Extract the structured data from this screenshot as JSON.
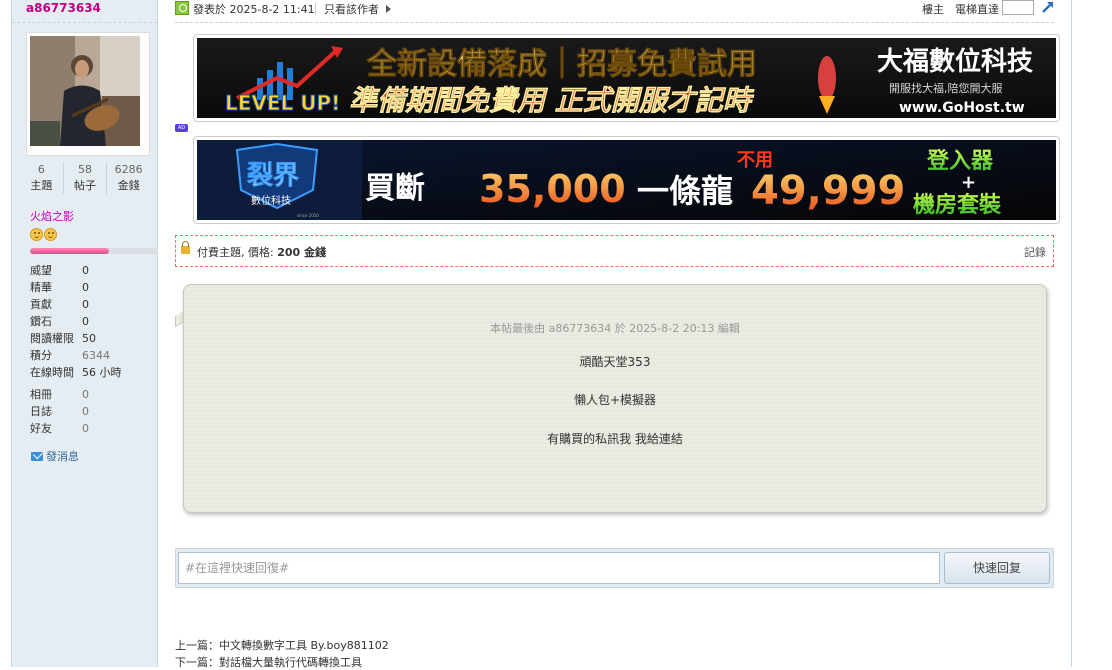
{
  "sidebar": {
    "username": "a86773634",
    "stats": [
      {
        "num": "6",
        "label": "主題"
      },
      {
        "num": "58",
        "label": "帖子"
      },
      {
        "num": "6286",
        "label": "金錢"
      }
    ],
    "group": "火焰之影",
    "level_progress": 0.62,
    "info": [
      {
        "k": "威望",
        "v": "0"
      },
      {
        "k": "精華",
        "v": "0"
      },
      {
        "k": "貢獻",
        "v": "0"
      },
      {
        "k": "鑽石",
        "v": "0"
      },
      {
        "k": "閱讀權限",
        "v": "50"
      },
      {
        "k": "積分",
        "v": "6344"
      },
      {
        "k": "在線時間",
        "v": "56 小時"
      }
    ],
    "info2": [
      {
        "k": "相冊",
        "v": "0"
      },
      {
        "k": "日誌",
        "v": "0"
      },
      {
        "k": "好友",
        "v": "0"
      }
    ],
    "send_message": "發消息"
  },
  "topbar": {
    "posted": "發表於 2025-8-2 11:41",
    "author_only": "只看該作者",
    "floor_host": "樓主",
    "elevator": "電梯直達"
  },
  "banner1": {
    "headline": "全新設備落成｜招募免費試用",
    "subline": "準備期間免費用 正式開服才記時",
    "level_up": "LEVEL UP!",
    "brand": "大福數位科技",
    "brand_sub": "開服找大福,陪您開大服",
    "url": "www.GoHost.tw"
  },
  "ad_tag": "AD",
  "banner2": {
    "logo": "裂界",
    "logo_sub": "數位科技",
    "since": "since 2010",
    "buyout": "買斷",
    "price1": "35,000",
    "dragon": "一條龍",
    "no_need": "不用",
    "price2": "49,999",
    "login": "登入器",
    "plus": "+",
    "room": "機房套裝"
  },
  "paid": {
    "text": "付費主題, 價格: ",
    "price": "200 金錢",
    "records": "記錄"
  },
  "post": {
    "edited": "本帖最後由 a86773634 於 2025-8-2 20:13 編輯",
    "lines": [
      "頑酷天堂353",
      "懶人包+模擬器",
      "有購買的私訊我 我給連結"
    ]
  },
  "reply": {
    "placeholder": "#在這裡快速回復#",
    "button": "快速回复"
  },
  "nav": {
    "prev": "上一篇：中文轉換數字工具 By.boy881102",
    "next": "下一篇：對話檔大量執行代碼轉換工具"
  },
  "colors": {
    "username": "#c00080",
    "group": "#c000c0",
    "sidebar_bg": "#e5edf2",
    "paid_border": "#f26c6c"
  }
}
